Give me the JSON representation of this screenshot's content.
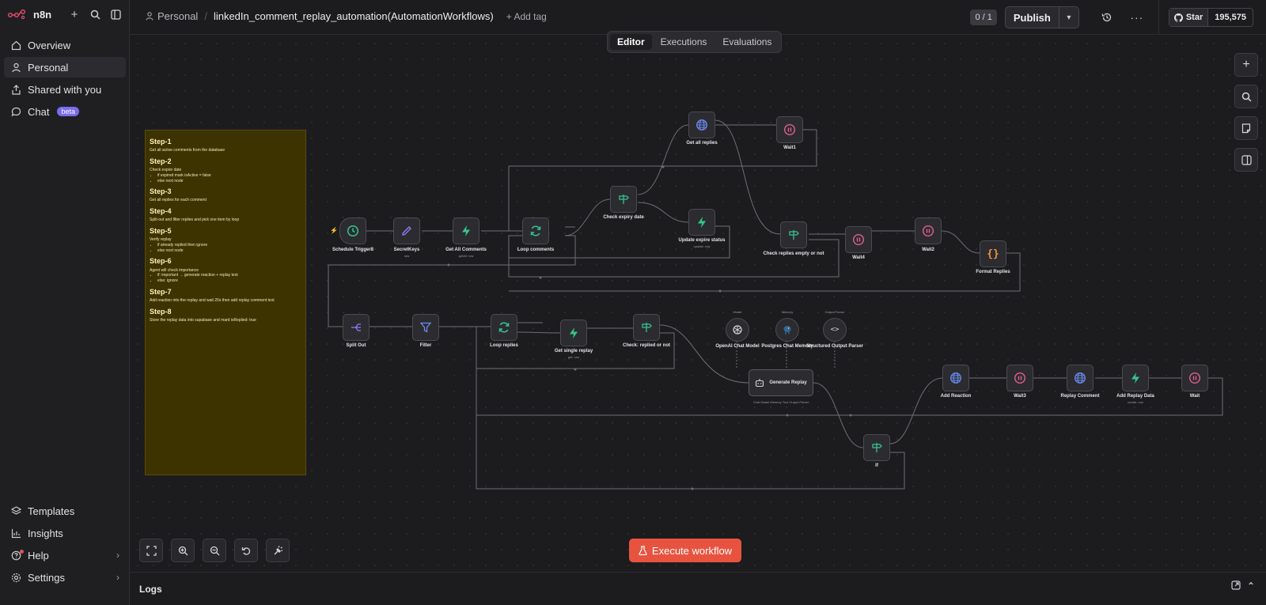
{
  "app": {
    "logo_text": "n8n"
  },
  "sidebar": {
    "items": [
      {
        "label": "Overview",
        "icon": "home-icon"
      },
      {
        "label": "Personal",
        "icon": "user-icon",
        "active": true
      },
      {
        "label": "Shared with you",
        "icon": "share-icon"
      },
      {
        "label": "Chat",
        "icon": "chat-icon",
        "badge": "beta"
      }
    ],
    "bottom_items": [
      {
        "label": "Templates",
        "icon": "templates-icon"
      },
      {
        "label": "Insights",
        "icon": "insights-icon"
      },
      {
        "label": "Help",
        "icon": "help-icon"
      },
      {
        "label": "Settings",
        "icon": "settings-icon"
      }
    ]
  },
  "header": {
    "project": "Personal",
    "workflow_name": "linkedIn_comment_replay_automation(AutomationWorkflows)",
    "add_tag": "+ Add tag",
    "counter": "0 / 1",
    "publish_label": "Publish",
    "star_label": "Star",
    "star_count": "195,575"
  },
  "tabs": [
    "Editor",
    "Executions",
    "Evaluations"
  ],
  "sticky": {
    "steps": [
      {
        "title": "Step-1",
        "text": "Get all active comments from the database",
        "bullets": []
      },
      {
        "title": "Step-2",
        "text": "Check expire date",
        "bullets": [
          "if expired mark isActive = false",
          "else next node"
        ]
      },
      {
        "title": "Step-3",
        "text": "Get all replies for each comment",
        "bullets": []
      },
      {
        "title": "Step-4",
        "text": "Split-out and filter replies and pick one item by loop",
        "bullets": []
      },
      {
        "title": "Step-5",
        "text": "Verify replay",
        "bullets": [
          "if already replied then ignore",
          "else next node"
        ]
      },
      {
        "title": "Step-6",
        "text": "Agent will check importance",
        "bullets": [
          "if: important → generate reaction + replay text",
          "else: ignore"
        ]
      },
      {
        "title": "Step-7",
        "text": "Add reaction into the replay and wait 20s then add replay comment text",
        "bullets": []
      },
      {
        "title": "Step-8",
        "text": "Store the replay data into supabase and mard isReplied: true",
        "bullets": []
      }
    ]
  },
  "nodes": {
    "schedule": {
      "label": "Schedule Trigger8"
    },
    "secretkeys": {
      "label": "SecretKeys",
      "sub": "raw"
    },
    "get_all_comments": {
      "label": "Get All Comments",
      "sub": "getAll: row"
    },
    "loop_comments": {
      "label": "Loop comments"
    },
    "check_expiry": {
      "label": "Check expiry date"
    },
    "get_all_replies": {
      "label": "Get all replies"
    },
    "wait1": {
      "label": "Wait1"
    },
    "update_expire": {
      "label": "Update expire status",
      "sub": "update: row"
    },
    "check_replies_empty": {
      "label": "Check replies empty or not"
    },
    "wait4": {
      "label": "Wait4"
    },
    "wait2": {
      "label": "Wait2"
    },
    "format_replies": {
      "label": "Format Replies"
    },
    "split_out": {
      "label": "Split Out"
    },
    "filter": {
      "label": "Filter"
    },
    "loop_replies": {
      "label": "Loop replies"
    },
    "get_single_replay": {
      "label": "Get single replay",
      "sub": "get: row"
    },
    "check_replied": {
      "label": "Check: replied or not"
    },
    "openai": {
      "label": "OpenAI Chat Model",
      "top": "Model"
    },
    "postgres": {
      "label": "Postgres Chat Memory",
      "top": "Memory"
    },
    "structured": {
      "label": "Structured Output Parser",
      "top": "Output Parser"
    },
    "generate_replay": {
      "label": "Generate Replay",
      "sub": "Chat Model  Memory  Tool  Output Parser"
    },
    "if": {
      "label": "If"
    },
    "add_reaction": {
      "label": "Add Reaction"
    },
    "wait3": {
      "label": "Wait3"
    },
    "replay_comment": {
      "label": "Replay Comment"
    },
    "add_replay_data": {
      "label": "Add Replay Data",
      "sub": "create: row"
    },
    "wait": {
      "label": "Wait"
    }
  },
  "execute_label": "Execute workflow",
  "logs_label": "Logs",
  "colors": {
    "accent": "#e8533f",
    "sticky_bg": "#3d3300",
    "green": "#35c48b",
    "purple": "#8a7cf5",
    "blue": "#6a8cf0",
    "pink": "#e0608a",
    "orange": "#f0913a"
  }
}
